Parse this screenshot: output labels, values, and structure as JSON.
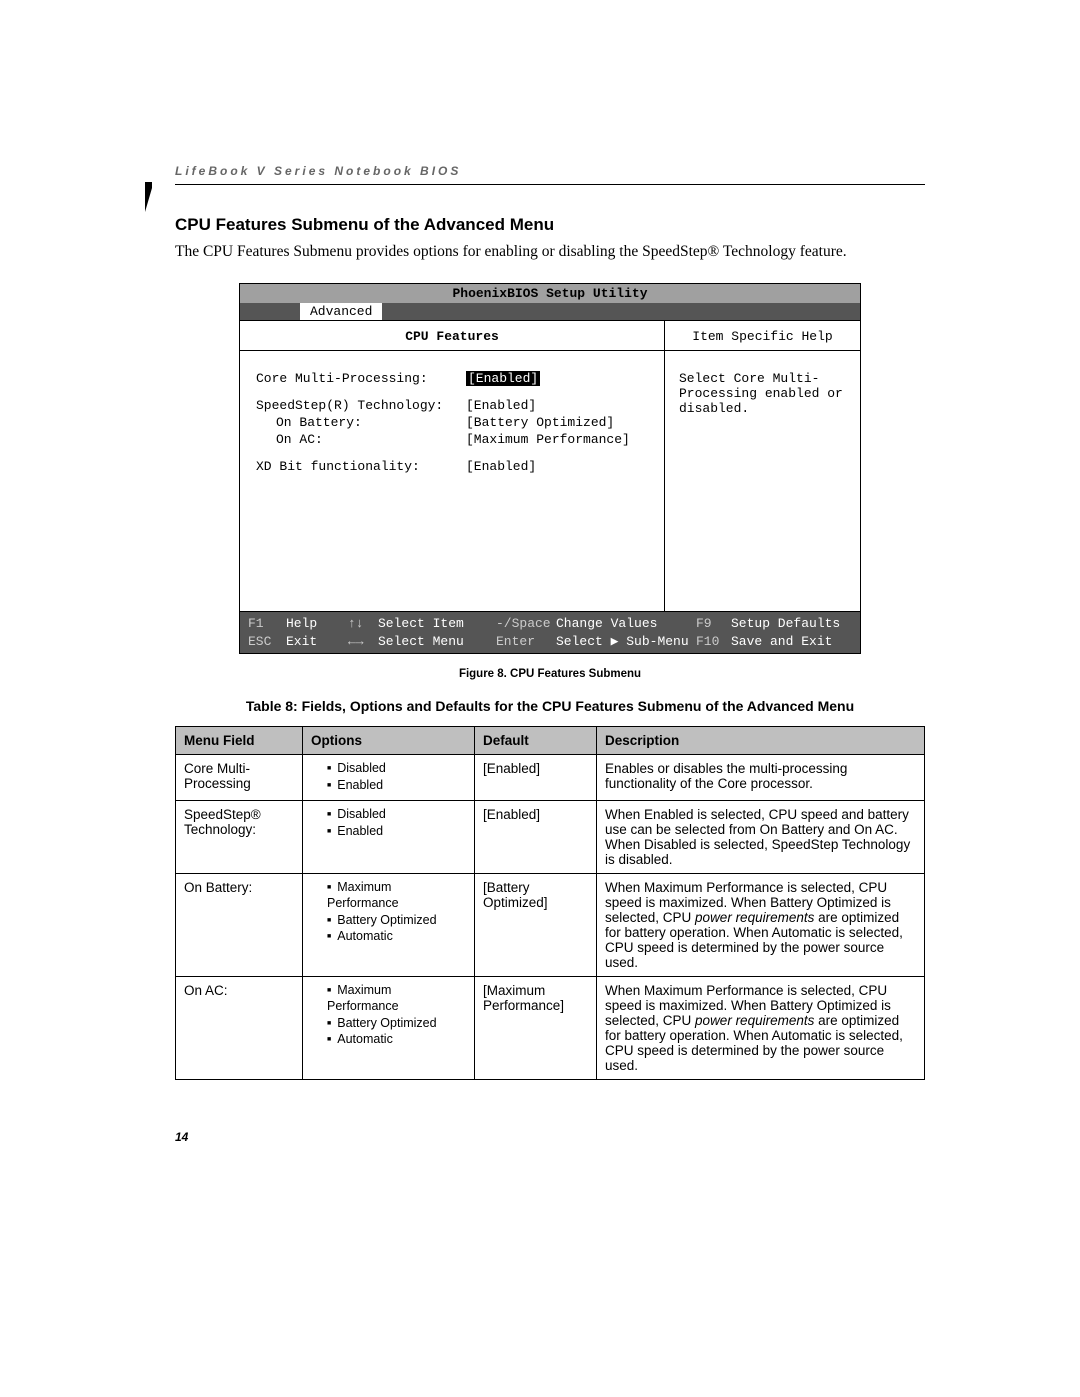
{
  "header": "LifeBook V Series Notebook BIOS",
  "section_title": "CPU Features Submenu of the Advanced Menu",
  "intro": "The CPU Features Submenu provides options for enabling or disabling the SpeedStep® Technology feature.",
  "bios": {
    "title": "PhoenixBIOS Setup Utility",
    "active_tab": "Advanced",
    "left_title": "CPU Features",
    "right_title": "Item Specific Help",
    "help_text": "Select Core Multi-Processing enabled or disabled.",
    "rows": {
      "r1_label": "Core Multi-Processing:",
      "r1_value": "[Enabled]",
      "r2_label": "SpeedStep(R) Technology:",
      "r2_value": "[Enabled]",
      "r3_label": "On Battery:",
      "r3_value": "[Battery Optimized]",
      "r4_label": "On AC:",
      "r4_value": "[Maximum Performance]",
      "r5_label": "XD Bit functionality:",
      "r5_value": "[Enabled]"
    },
    "footer": {
      "f1_key": "F1",
      "f1_label": "Help",
      "arrows_v": "↑↓",
      "select_item": "Select Item",
      "space_key": "-/Space",
      "change_values": "Change Values",
      "f9_key": "F9",
      "f9_label": "Setup Defaults",
      "esc_key": "ESC",
      "esc_label": "Exit",
      "arrows_h": "←→",
      "select_menu": "Select Menu",
      "enter_key": "Enter",
      "submenu": "Select ▶ Sub-Menu",
      "f10_key": "F10",
      "f10_label": "Save and Exit"
    }
  },
  "figure_caption": "Figure 8.  CPU Features Submenu",
  "table_caption": "Table 8: Fields, Options and Defaults for the CPU Features Submenu of the Advanced Menu",
  "columns": {
    "c1": "Menu Field",
    "c2": "Options",
    "c3": "Default",
    "c4": "Description"
  },
  "table_rows": [
    {
      "field": "Core Multi-Processing",
      "options": [
        "Disabled",
        "Enabled"
      ],
      "default": "[Enabled]",
      "desc_a": "Enables or disables the multi-processing functionality of the Core processor.",
      "desc_i": "",
      "desc_b": ""
    },
    {
      "field": "SpeedStep® Technology:",
      "options": [
        "Disabled",
        "Enabled"
      ],
      "default": "[Enabled]",
      "desc_a": "When Enabled is selected, CPU speed and battery use can be selected from On Battery and On AC. When Disabled is selected, SpeedStep Technology is disabled.",
      "desc_i": "",
      "desc_b": ""
    },
    {
      "field": "On Battery:",
      "options": [
        "Maximum Performance",
        "Battery Optimized",
        "Automatic"
      ],
      "default": "[Battery Optimized]",
      "desc_a": "When Maximum Performance is selected, CPU speed is maximized. When Battery Optimized is selected, CPU ",
      "desc_i": "power requirements",
      "desc_b": " are optimized for battery operation. When Automatic is selected, CPU speed is determined by the power source used."
    },
    {
      "field": "On AC:",
      "options": [
        "Maximum Performance",
        "Battery Optimized",
        "Automatic"
      ],
      "default": "[Maximum Performance]",
      "desc_a": "When Maximum Performance is selected, CPU speed is maximized. When Battery Optimized is selected, CPU ",
      "desc_i": "power requirements",
      "desc_b": " are optimized for battery operation. When Automatic is selected, CPU speed is determined by the power source used."
    }
  ],
  "page_number": "14"
}
